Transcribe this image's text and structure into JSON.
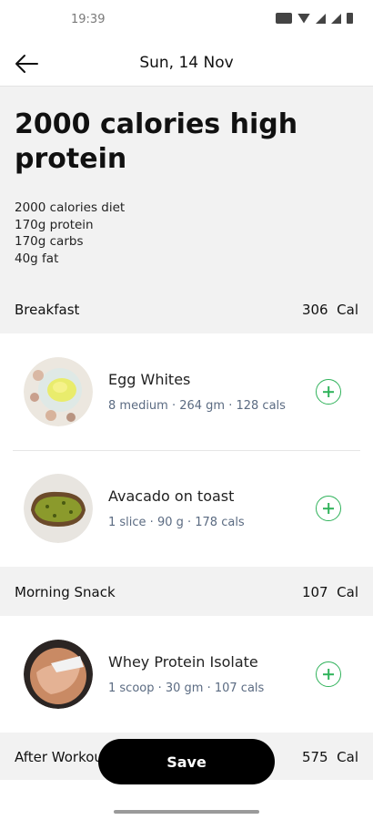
{
  "status_bar": {
    "time": "19:39"
  },
  "header": {
    "title": "Sun, 14 Nov",
    "back_icon": "arrow-left-icon"
  },
  "plan": {
    "title": "2000 calories high protein",
    "details": [
      "2000 calories diet",
      "170g protein",
      "170g carbs",
      "40g fat"
    ]
  },
  "sections": [
    {
      "name": "Breakfast",
      "calories": "306",
      "unit": "Cal",
      "items": [
        {
          "name": "Egg Whites",
          "meta": "8 medium · 264 gm · 128 cals"
        },
        {
          "name": "Avacado on toast",
          "meta": "1 slice · 90 g · 178 cals"
        }
      ]
    },
    {
      "name": "Morning Snack",
      "calories": "107",
      "unit": "Cal",
      "items": [
        {
          "name": "Whey Protein Isolate",
          "meta": "1 scoop · 30 gm · 107 cals"
        }
      ]
    },
    {
      "name": "After Workout",
      "calories": "575",
      "unit": "Cal",
      "items": []
    }
  ],
  "save_label": "Save",
  "colors": {
    "accent": "#2fb25a",
    "meta_text": "#5b6b82",
    "button": "#000000"
  }
}
